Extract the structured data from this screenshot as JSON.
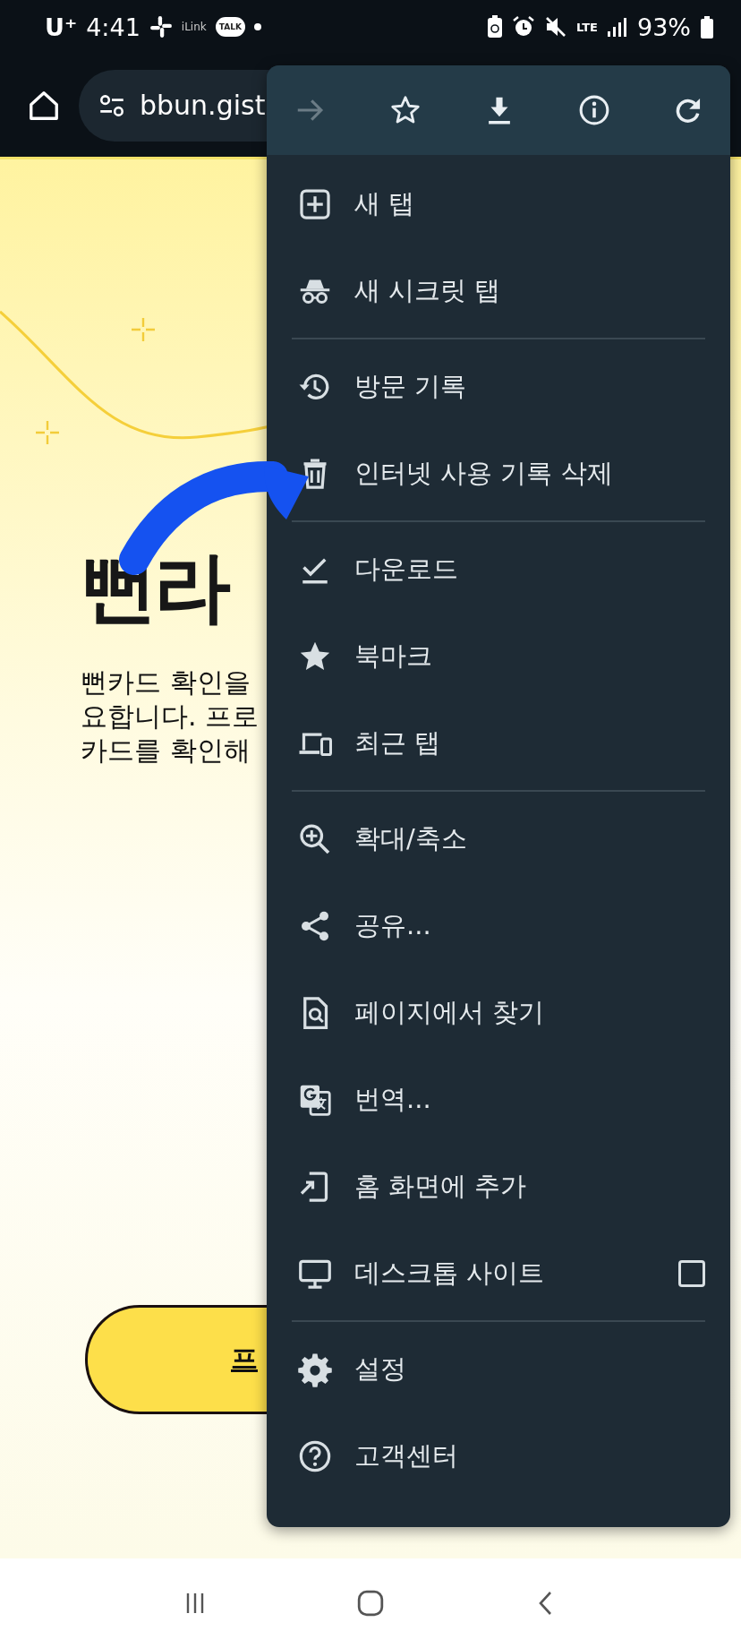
{
  "status_bar": {
    "carrier": "U⁺",
    "time": "4:41",
    "app_label": "iLink",
    "chat_badge": "TALK",
    "network": "LTE",
    "battery": "93%"
  },
  "address_bar": {
    "url": "bbun.gist"
  },
  "page": {
    "heading": "뻔라",
    "body_lines": [
      "뻔카드 확인을",
      "요합니다. 프로",
      "카드를 확인해"
    ],
    "button": "프"
  },
  "menu": {
    "action_icons": [
      {
        "disabled": true
      },
      {
        "disabled": false
      },
      {
        "disabled": false
      },
      {
        "disabled": false
      },
      {
        "disabled": false
      }
    ],
    "groups": [
      [
        {
          "label": "새 탭"
        },
        {
          "label": "새 시크릿 탭"
        }
      ],
      [
        {
          "label": "방문 기록"
        },
        {
          "label": "인터넷 사용 기록 삭제"
        }
      ],
      [
        {
          "label": "다운로드"
        },
        {
          "label": "북마크"
        },
        {
          "label": "최근 탭"
        }
      ],
      [
        {
          "label": "확대/축소"
        },
        {
          "label": "공유..."
        },
        {
          "label": "페이지에서 찾기"
        },
        {
          "label": "번역..."
        },
        {
          "label": "홈 화면에 추가"
        },
        {
          "label": "데스크톱 사이트",
          "checked": false
        }
      ],
      [
        {
          "label": "설정"
        },
        {
          "label": "고객센터"
        }
      ]
    ]
  }
}
